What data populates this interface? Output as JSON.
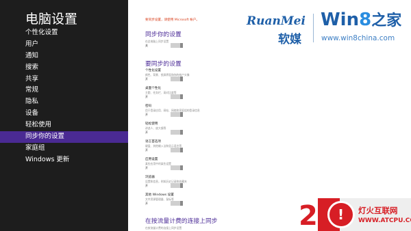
{
  "nav": {
    "title": "电脑设置",
    "items": [
      {
        "label": "个性化设置",
        "selected": false
      },
      {
        "label": "用户",
        "selected": false
      },
      {
        "label": "通知",
        "selected": false
      },
      {
        "label": "搜索",
        "selected": false
      },
      {
        "label": "共享",
        "selected": false
      },
      {
        "label": "常规",
        "selected": false
      },
      {
        "label": "隐私",
        "selected": false
      },
      {
        "label": "设备",
        "selected": false
      },
      {
        "label": "轻松使用",
        "selected": false
      },
      {
        "label": "同步你的设置",
        "selected": true
      },
      {
        "label": "家庭组",
        "selected": false
      },
      {
        "label": "Windows 更新",
        "selected": false
      }
    ]
  },
  "content": {
    "warning": "要同步设置，请使用 Microsoft 帐户。",
    "sync_section": {
      "title": "同步你的设置",
      "setting": {
        "title": "在此电脑上同步设置",
        "state": "关"
      }
    },
    "what_section": {
      "title": "要同步的设置",
      "settings": [
        {
          "title": "个性化设置",
          "desc": "颜色、背景、锁屏界面和你的帐户头像",
          "state": "开"
        },
        {
          "title": "桌面个性化",
          "desc": "主题、任务栏、高对比度等",
          "state": "开"
        },
        {
          "title": "密码",
          "desc": "用于登录应用、网站、网络和家庭组的登录信息",
          "state": "开"
        },
        {
          "title": "轻松使用",
          "desc": "讲述人、放大镜等",
          "state": "开"
        },
        {
          "title": "语言首选项",
          "desc": "键盘、其他输入法和显示语言等",
          "state": "开"
        },
        {
          "title": "应用设置",
          "desc": "某些应用中的某些设置",
          "state": "开"
        },
        {
          "title": "浏览器",
          "desc": "设置和信息，例如历史记录和收藏夹",
          "state": "开"
        },
        {
          "title": "其他 Windows 设置",
          "desc": "文件资源管理器、鼠标等",
          "state": "开"
        }
      ]
    },
    "metered_section": {
      "title": "在按流量计费的连接上同步",
      "setting": {
        "title": "在按流量计费的连接上同步设置"
      }
    }
  },
  "watermarks": {
    "ruanmei_name": "RuanMei",
    "ruanmei_cn": "软媒",
    "win8_win": "Win",
    "win8_eight": "8",
    "win8_cn": "之家",
    "win8_url": "www.win8china.com",
    "atcpu_mark": "!",
    "atcpu_name": "灯火互联网",
    "atcpu_url": "WWW.ATCPU.COM",
    "atcpu_digit": "2"
  },
  "colors": {
    "nav_background": "#1d1d1d",
    "selected_background": "#4a2a93",
    "section_title": "#4e2e98",
    "warning": "#d9411e"
  }
}
